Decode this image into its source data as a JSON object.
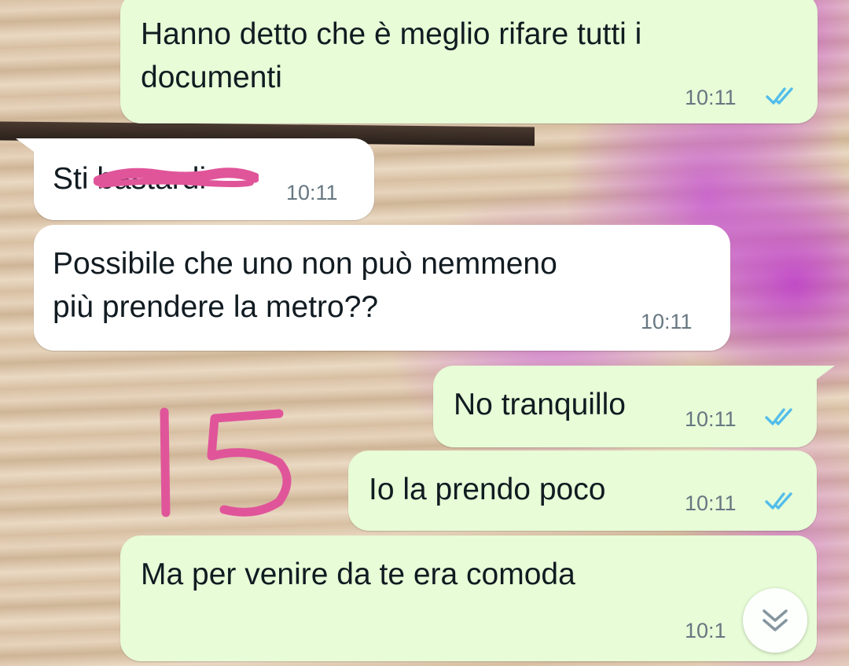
{
  "messages": [
    {
      "direction": "outgoing",
      "text": "Hanno detto che è meglio rifare tutti i\ndocumenti",
      "time": "10:11",
      "status": "read"
    },
    {
      "direction": "incoming",
      "text": "Sti b",
      "redacted_tail": "astardi",
      "time": "10:11"
    },
    {
      "direction": "incoming",
      "text": "Possibile che uno non può nemmeno\npiù prendere la metro??",
      "time": "10:11"
    },
    {
      "direction": "outgoing",
      "text": "No tranquillo",
      "time": "10:11",
      "status": "read"
    },
    {
      "direction": "outgoing",
      "text": "Io la prendo poco",
      "time": "10:11",
      "status": "read"
    },
    {
      "direction": "outgoing",
      "text": "Ma per venire da te era comoda",
      "time": "10:1",
      "status": "read"
    }
  ],
  "annotation": {
    "text": "15",
    "color": "#e0559a"
  },
  "colors": {
    "outgoing_bubble": "#e7fcd7",
    "incoming_bubble": "#ffffff",
    "read_ticks": "#53bdeb",
    "time_text": "#667781",
    "redaction": "#e0559a"
  },
  "icons": {
    "read_receipt": "double-check-icon",
    "scroll_down": "chevron-double-down-icon"
  }
}
